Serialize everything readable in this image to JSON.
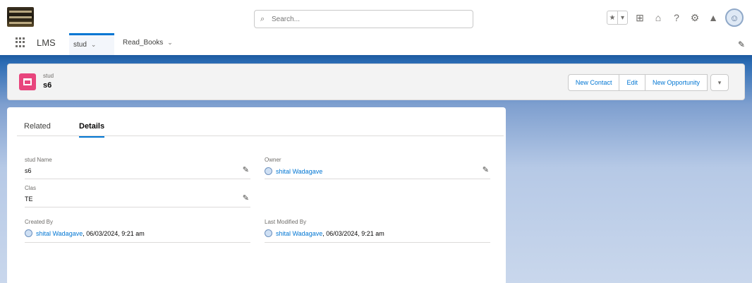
{
  "header": {
    "search_placeholder": "Search...",
    "icons": [
      "favorites-star-icon",
      "favorites-list-icon",
      "global-actions-icon",
      "trailhead-icon",
      "help-icon",
      "setup-gear-icon",
      "notifications-bell-icon",
      "user-avatar-icon"
    ]
  },
  "nav": {
    "app_name": "LMS",
    "tabs": [
      {
        "label": "stud",
        "active": true
      },
      {
        "label": "Read_Books",
        "active": false
      }
    ]
  },
  "record": {
    "object_label": "stud",
    "title": "s6",
    "actions": [
      "New Contact",
      "Edit",
      "New Opportunity"
    ]
  },
  "detail_tabs": [
    {
      "label": "Related",
      "active": false
    },
    {
      "label": "Details",
      "active": true
    }
  ],
  "fields": {
    "stud_name": {
      "label": "stud Name",
      "value": "s6"
    },
    "owner": {
      "label": "Owner",
      "value": "shital Wadagave"
    },
    "clas": {
      "label": "Clas",
      "value": "TE"
    },
    "created_by": {
      "label": "Created By",
      "user": "shital Wadagave",
      "date": ", 06/03/2024, 9:21 am"
    },
    "last_modified_by": {
      "label": "Last Modified By",
      "user": "shital Wadagave",
      "date": ", 06/03/2024, 9:21 am"
    }
  },
  "colors": {
    "brand_blue": "#0176d3",
    "object_icon": "#e8457d",
    "band_top": "#1d5aa0"
  }
}
